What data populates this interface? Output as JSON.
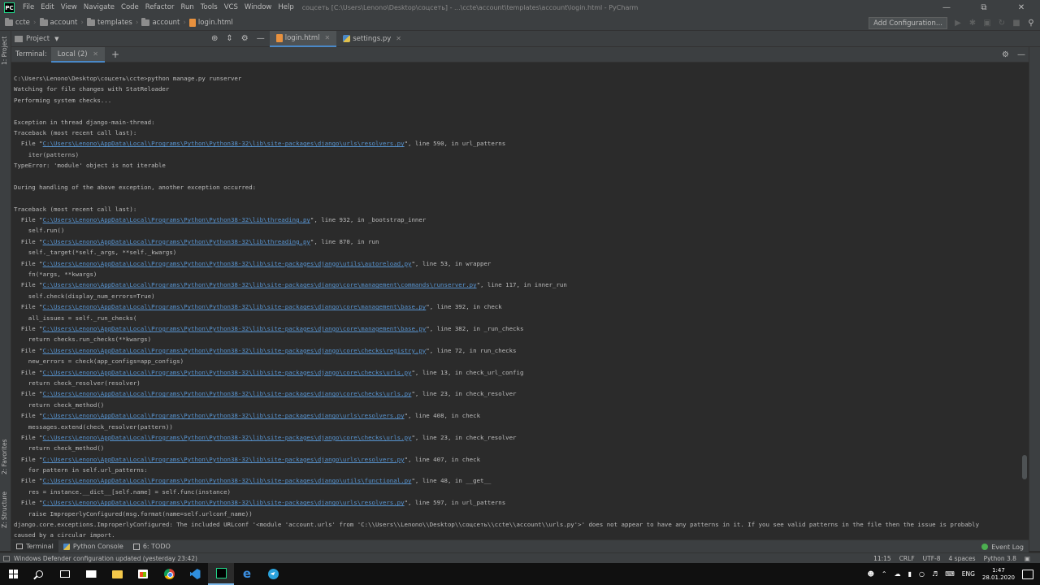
{
  "app": {
    "logo_text": "PC",
    "window_title": "соцсеть [C:\\Users\\Lenono\\Desktop\\соцсеть] - ...\\ccte\\account\\templates\\account\\login.html - PyCharm"
  },
  "menu": [
    "File",
    "Edit",
    "View",
    "Navigate",
    "Code",
    "Refactor",
    "Run",
    "Tools",
    "VCS",
    "Window",
    "Help"
  ],
  "breadcrumb": [
    "ccte",
    "account",
    "templates",
    "account",
    "login.html"
  ],
  "toolbar": {
    "add_config_label": "Add Configuration..."
  },
  "project": {
    "label": "Project"
  },
  "tabs": [
    {
      "label": "login.html",
      "active": true
    },
    {
      "label": "settings.py",
      "active": false
    }
  ],
  "left_stripe": {
    "project": "1: Project",
    "favorites": "2: Favorites",
    "structure": "Z: Structure"
  },
  "terminal": {
    "label": "Terminal:",
    "tab": "Local (2)",
    "lines": [
      {
        "t": "C:\\Users\\Lenono\\Desktop\\соцсеть\\ccte>python manage.py runserver"
      },
      {
        "t": "Watching for file changes with StatReloader"
      },
      {
        "t": "Performing system checks..."
      },
      {
        "t": ""
      },
      {
        "t": "Exception in thread django-main-thread:"
      },
      {
        "t": "Traceback (most recent call last):"
      },
      {
        "p": "  File \"",
        "l": "C:\\Users\\Lenono\\AppData\\Local\\Programs\\Python\\Python38-32\\lib\\site-packages\\django\\urls\\resolvers.py",
        "s": "\", line 590, in url_patterns"
      },
      {
        "t": "    iter(patterns)"
      },
      {
        "t": "TypeError: 'module' object is not iterable"
      },
      {
        "t": ""
      },
      {
        "t": "During handling of the above exception, another exception occurred:"
      },
      {
        "t": ""
      },
      {
        "t": "Traceback (most recent call last):"
      },
      {
        "p": "  File \"",
        "l": "C:\\Users\\Lenono\\AppData\\Local\\Programs\\Python\\Python38-32\\lib\\threading.py",
        "s": "\", line 932, in _bootstrap_inner"
      },
      {
        "t": "    self.run()"
      },
      {
        "p": "  File \"",
        "l": "C:\\Users\\Lenono\\AppData\\Local\\Programs\\Python\\Python38-32\\lib\\threading.py",
        "s": "\", line 870, in run"
      },
      {
        "t": "    self._target(*self._args, **self._kwargs)"
      },
      {
        "p": "  File \"",
        "l": "C:\\Users\\Lenono\\AppData\\Local\\Programs\\Python\\Python38-32\\lib\\site-packages\\django\\utils\\autoreload.py",
        "s": "\", line 53, in wrapper"
      },
      {
        "t": "    fn(*args, **kwargs)"
      },
      {
        "p": "  File \"",
        "l": "C:\\Users\\Lenono\\AppData\\Local\\Programs\\Python\\Python38-32\\lib\\site-packages\\django\\core\\management\\commands\\runserver.py",
        "s": "\", line 117, in inner_run"
      },
      {
        "t": "    self.check(display_num_errors=True)"
      },
      {
        "p": "  File \"",
        "l": "C:\\Users\\Lenono\\AppData\\Local\\Programs\\Python\\Python38-32\\lib\\site-packages\\django\\core\\management\\base.py",
        "s": "\", line 392, in check"
      },
      {
        "t": "    all_issues = self._run_checks("
      },
      {
        "p": "  File \"",
        "l": "C:\\Users\\Lenono\\AppData\\Local\\Programs\\Python\\Python38-32\\lib\\site-packages\\django\\core\\management\\base.py",
        "s": "\", line 382, in _run_checks"
      },
      {
        "t": "    return checks.run_checks(**kwargs)"
      },
      {
        "p": "  File \"",
        "l": "C:\\Users\\Lenono\\AppData\\Local\\Programs\\Python\\Python38-32\\lib\\site-packages\\django\\core\\checks\\registry.py",
        "s": "\", line 72, in run_checks"
      },
      {
        "t": "    new_errors = check(app_configs=app_configs)"
      },
      {
        "p": "  File \"",
        "l": "C:\\Users\\Lenono\\AppData\\Local\\Programs\\Python\\Python38-32\\lib\\site-packages\\django\\core\\checks\\urls.py",
        "s": "\", line 13, in check_url_config"
      },
      {
        "t": "    return check_resolver(resolver)"
      },
      {
        "p": "  File \"",
        "l": "C:\\Users\\Lenono\\AppData\\Local\\Programs\\Python\\Python38-32\\lib\\site-packages\\django\\core\\checks\\urls.py",
        "s": "\", line 23, in check_resolver"
      },
      {
        "t": "    return check_method()"
      },
      {
        "p": "  File \"",
        "l": "C:\\Users\\Lenono\\AppData\\Local\\Programs\\Python\\Python38-32\\lib\\site-packages\\django\\urls\\resolvers.py",
        "s": "\", line 408, in check"
      },
      {
        "t": "    messages.extend(check_resolver(pattern))"
      },
      {
        "p": "  File \"",
        "l": "C:\\Users\\Lenono\\AppData\\Local\\Programs\\Python\\Python38-32\\lib\\site-packages\\django\\core\\checks\\urls.py",
        "s": "\", line 23, in check_resolver"
      },
      {
        "t": "    return check_method()"
      },
      {
        "p": "  File \"",
        "l": "C:\\Users\\Lenono\\AppData\\Local\\Programs\\Python\\Python38-32\\lib\\site-packages\\django\\urls\\resolvers.py",
        "s": "\", line 407, in check"
      },
      {
        "t": "    for pattern in self.url_patterns:"
      },
      {
        "p": "  File \"",
        "l": "C:\\Users\\Lenono\\AppData\\Local\\Programs\\Python\\Python38-32\\lib\\site-packages\\django\\utils\\functional.py",
        "s": "\", line 48, in __get__"
      },
      {
        "t": "    res = instance.__dict__[self.name] = self.func(instance)"
      },
      {
        "p": "  File \"",
        "l": "C:\\Users\\Lenono\\AppData\\Local\\Programs\\Python\\Python38-32\\lib\\site-packages\\django\\urls\\resolvers.py",
        "s": "\", line 597, in url_patterns"
      },
      {
        "t": "    raise ImproperlyConfigured(msg.format(name=self.urlconf_name))"
      },
      {
        "t": "django.core.exceptions.ImproperlyConfigured: The included URLconf '<module 'account.urls' from 'C:\\\\Users\\\\Lenono\\\\Desktop\\\\соцсеть\\\\ccte\\\\account\\\\urls.py'>' does not appear to have any patterns in it. If you see valid patterns in the file then the issue is probably"
      },
      {
        "t": "caused by a circular import."
      }
    ]
  },
  "bottom_tools": [
    {
      "label": "Terminal",
      "icon": "terminal-icon",
      "active": true
    },
    {
      "label": "Python Console",
      "icon": "python-console-icon",
      "active": false
    },
    {
      "label": "6: TODO",
      "icon": "todo-icon",
      "active": false
    }
  ],
  "event_log": "Event Log",
  "status": {
    "message": "Windows Defender configuration updated (yesterday 23:42)",
    "position": "11:15",
    "line_sep": "CRLF",
    "encoding": "UTF-8",
    "indent": "4 spaces",
    "interpreter": "Python 3.8"
  },
  "taskbar": {
    "language": "ENG",
    "time": "1:47",
    "date": "28.01.2020"
  },
  "colors": {
    "link": "#5894d0",
    "accent": "#4a88c7",
    "background": "#2b2b2b",
    "panel": "#3c3f41"
  }
}
